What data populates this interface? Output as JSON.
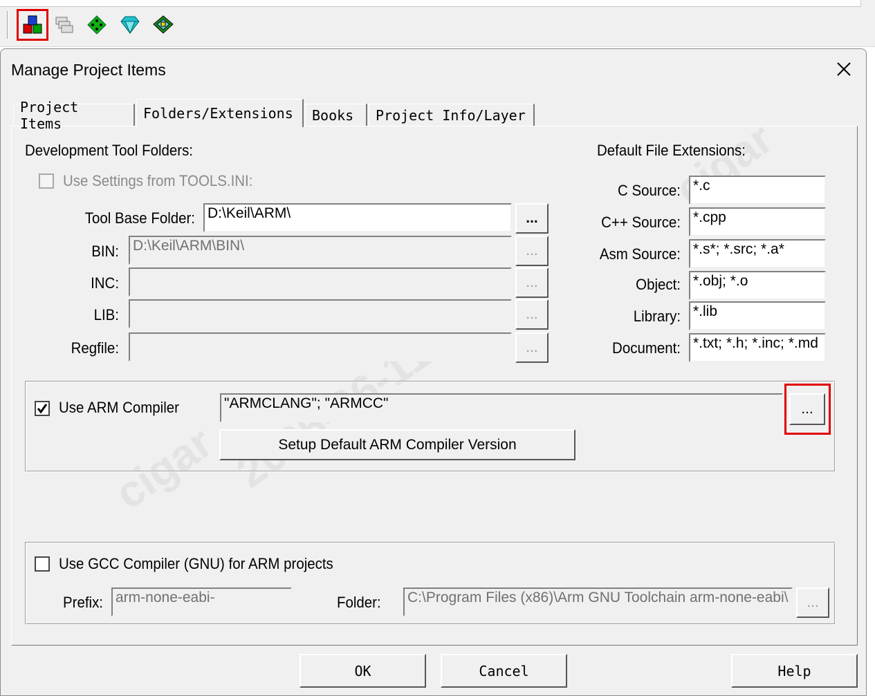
{
  "toolbar": {
    "icons": [
      "project-items-icon",
      "multi-window-icon",
      "green-diamond-icon",
      "cyan-diamond-icon",
      "pack-installer-icon"
    ]
  },
  "dialog": {
    "title": "Manage Project Items",
    "tabs": [
      "Project Items",
      "Folders/Extensions",
      "Books",
      "Project Info/Layer"
    ],
    "active_tab": "Folders/Extensions"
  },
  "dev_tools": {
    "heading": "Development Tool Folders:",
    "use_tools_ini_label": "Use Settings from TOOLS.INI:",
    "use_tools_ini_checked": false,
    "rows": [
      {
        "label": "Tool Base Folder:",
        "value": "D:\\Keil\\ARM\\",
        "enabled": true
      },
      {
        "label": "BIN:",
        "value": "D:\\Keil\\ARM\\BIN\\",
        "enabled": false
      },
      {
        "label": "INC:",
        "value": "",
        "enabled": false
      },
      {
        "label": "LIB:",
        "value": "",
        "enabled": false
      },
      {
        "label": "Regfile:",
        "value": "",
        "enabled": false
      }
    ],
    "browse_label": "..."
  },
  "extensions": {
    "heading": "Default File Extensions:",
    "rows": [
      {
        "label": "C Source:",
        "value": "*.c"
      },
      {
        "label": "C++ Source:",
        "value": "*.cpp"
      },
      {
        "label": "Asm Source:",
        "value": "*.s*; *.src; *.a*"
      },
      {
        "label": "Object:",
        "value": "*.obj; *.o"
      },
      {
        "label": "Library:",
        "value": "*.lib"
      },
      {
        "label": "Document:",
        "value": "*.txt; *.h; *.inc; *.md"
      }
    ]
  },
  "arm_compiler": {
    "checkbox_label": "Use ARM Compiler",
    "checked": true,
    "value": "\"ARMCLANG\"; \"ARMCC\"",
    "browse_label": "...",
    "setup_button": "Setup Default ARM Compiler Version"
  },
  "gcc_compiler": {
    "checkbox_label": "Use GCC Compiler (GNU) for ARM projects",
    "checked": false,
    "prefix_label": "Prefix:",
    "prefix_value": "arm-none-eabi-",
    "folder_label": "Folder:",
    "folder_value": "C:\\Program Files (x86)\\Arm GNU Toolchain arm-none-eabi\\",
    "browse_label": "..."
  },
  "buttons": {
    "ok": "OK",
    "cancel": "Cancel",
    "help": "Help"
  },
  "watermark": [
    "cigar",
    "2025-06-11"
  ],
  "colors": {
    "highlight": "#e00000",
    "dialog_bg": "#f0f0f0"
  }
}
